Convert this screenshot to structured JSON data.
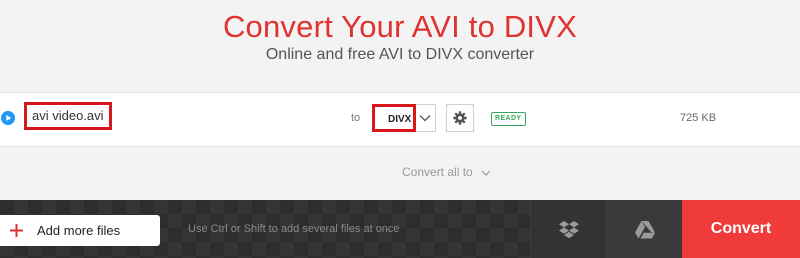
{
  "header": {
    "title": "Convert Your AVI to DIVX",
    "subtitle": "Online and free AVI to DIVX converter"
  },
  "file": {
    "name": "avi video.avi",
    "to_label": "to",
    "format": "DIVX",
    "status": "READY",
    "size": "725 KB"
  },
  "convert_all": {
    "label": "Convert all to"
  },
  "bottom_bar": {
    "add_files_label": "Add more files",
    "hint": "Use Ctrl or Shift to add several files at once",
    "convert_label": "Convert"
  },
  "icons": {
    "play": "play-circle-icon",
    "settings": "gear-icon",
    "dropbox": "dropbox-icon",
    "google_drive": "google-drive-icon",
    "add": "plus-icon",
    "chevron": "chevron-down-icon"
  },
  "colors": {
    "accent": "#e0322f",
    "convert": "#ef3b3a",
    "ready": "#3aa860",
    "highlight": "#d9161c",
    "play": "#2196f3"
  }
}
